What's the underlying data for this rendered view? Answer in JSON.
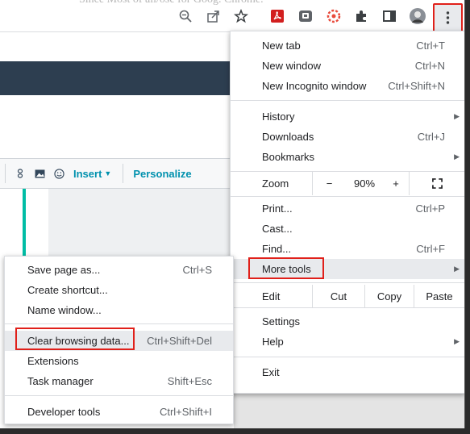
{
  "background_text": "Since Most of all/ose for Goog. Chrome.",
  "toolbar": {
    "icons": [
      "zoom-icon",
      "share-icon",
      "bookmark-star-icon",
      "pdf-extension-icon",
      "extension-icon",
      "colorful-extension-icon",
      "puzzle-extensions-icon",
      "side-panel-icon",
      "profile-avatar",
      "more-menu-icon"
    ]
  },
  "page": {
    "insert_label": "Insert",
    "personalize_label": "Personalize"
  },
  "menu": {
    "new_tab": {
      "label": "New tab",
      "shortcut": "Ctrl+T"
    },
    "new_window": {
      "label": "New window",
      "shortcut": "Ctrl+N"
    },
    "new_incognito": {
      "label": "New Incognito window",
      "shortcut": "Ctrl+Shift+N"
    },
    "history": {
      "label": "History"
    },
    "downloads": {
      "label": "Downloads",
      "shortcut": "Ctrl+J"
    },
    "bookmarks": {
      "label": "Bookmarks"
    },
    "zoom": {
      "label": "Zoom",
      "minus": "−",
      "value": "90%",
      "plus": "+"
    },
    "print": {
      "label": "Print...",
      "shortcut": "Ctrl+P"
    },
    "cast": {
      "label": "Cast..."
    },
    "find": {
      "label": "Find...",
      "shortcut": "Ctrl+F"
    },
    "more_tools": {
      "label": "More tools"
    },
    "edit": {
      "label": "Edit",
      "cut": "Cut",
      "copy": "Copy",
      "paste": "Paste"
    },
    "settings": {
      "label": "Settings"
    },
    "help": {
      "label": "Help"
    },
    "exit": {
      "label": "Exit"
    }
  },
  "submenu": {
    "save_page": {
      "label": "Save page as...",
      "shortcut": "Ctrl+S"
    },
    "create_shortcut": {
      "label": "Create shortcut..."
    },
    "name_window": {
      "label": "Name window..."
    },
    "clear_data": {
      "label": "Clear browsing data...",
      "shortcut": "Ctrl+Shift+Del"
    },
    "extensions": {
      "label": "Extensions"
    },
    "task_manager": {
      "label": "Task manager",
      "shortcut": "Shift+Esc"
    },
    "developer_tools": {
      "label": "Developer tools",
      "shortcut": "Ctrl+Shift+I"
    }
  },
  "colors": {
    "highlight_box": "#e0201a",
    "header_dark": "#2d3e50",
    "accent_link": "#0091ae"
  }
}
